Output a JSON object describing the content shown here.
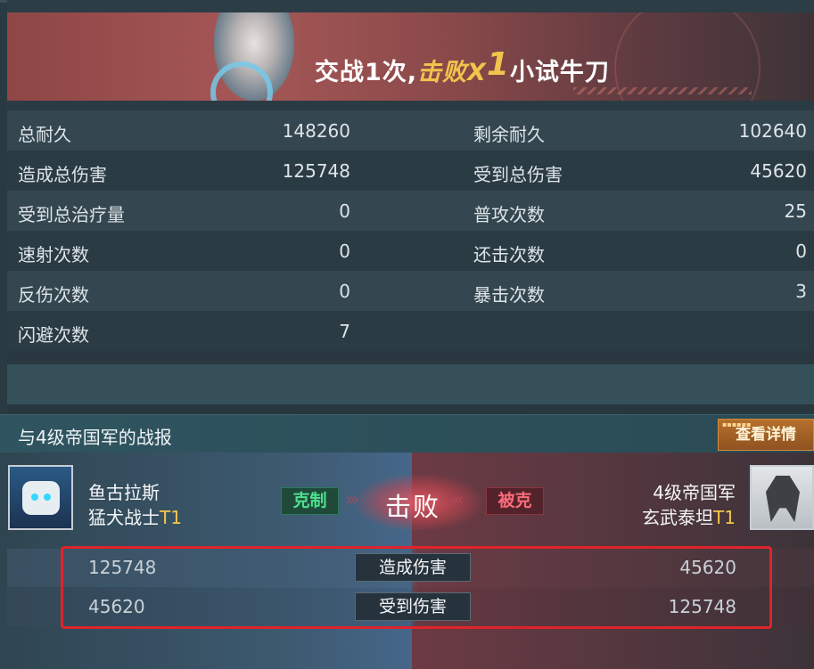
{
  "banner": {
    "prefix": "交战1次,",
    "defeat_word": "击败X",
    "defeat_count": "1",
    "title_suffix": "小试牛刀"
  },
  "stats": [
    {
      "left_label": "总耐久",
      "left_value": "148260",
      "right_label": "剩余耐久",
      "right_value": "102640"
    },
    {
      "left_label": "造成总伤害",
      "left_value": "125748",
      "right_label": "受到总伤害",
      "right_value": "45620"
    },
    {
      "left_label": "受到总治疗量",
      "left_value": "0",
      "right_label": "普攻次数",
      "right_value": "25"
    },
    {
      "left_label": "速射次数",
      "left_value": "0",
      "right_label": "还击次数",
      "right_value": "0"
    },
    {
      "left_label": "反伤次数",
      "left_value": "0",
      "right_label": "暴击次数",
      "right_value": "3"
    },
    {
      "left_label": "闪避次数",
      "left_value": "7",
      "right_label": "",
      "right_value": ""
    }
  ],
  "report": {
    "title": "与4级帝国军的战报",
    "detail_button": "查看详情"
  },
  "battle": {
    "left": {
      "name": "鱼古拉斯",
      "unit": "猛犬战士",
      "tier": "T1"
    },
    "right": {
      "name": "4级帝国军",
      "unit": "玄武泰坦",
      "tier": "T1"
    },
    "counter_badge": "克制",
    "countered_badge": "被克",
    "result": "击败",
    "rows": [
      {
        "left_value": "125748",
        "label": "造成伤害",
        "right_value": "45620"
      },
      {
        "left_value": "45620",
        "label": "受到伤害",
        "right_value": "125748"
      }
    ]
  },
  "colors": {
    "accent_gold": "#f3c748",
    "counter_green": "#4fe08e",
    "countered_red": "#ff6b7a",
    "highlight_red": "#e0232a"
  }
}
